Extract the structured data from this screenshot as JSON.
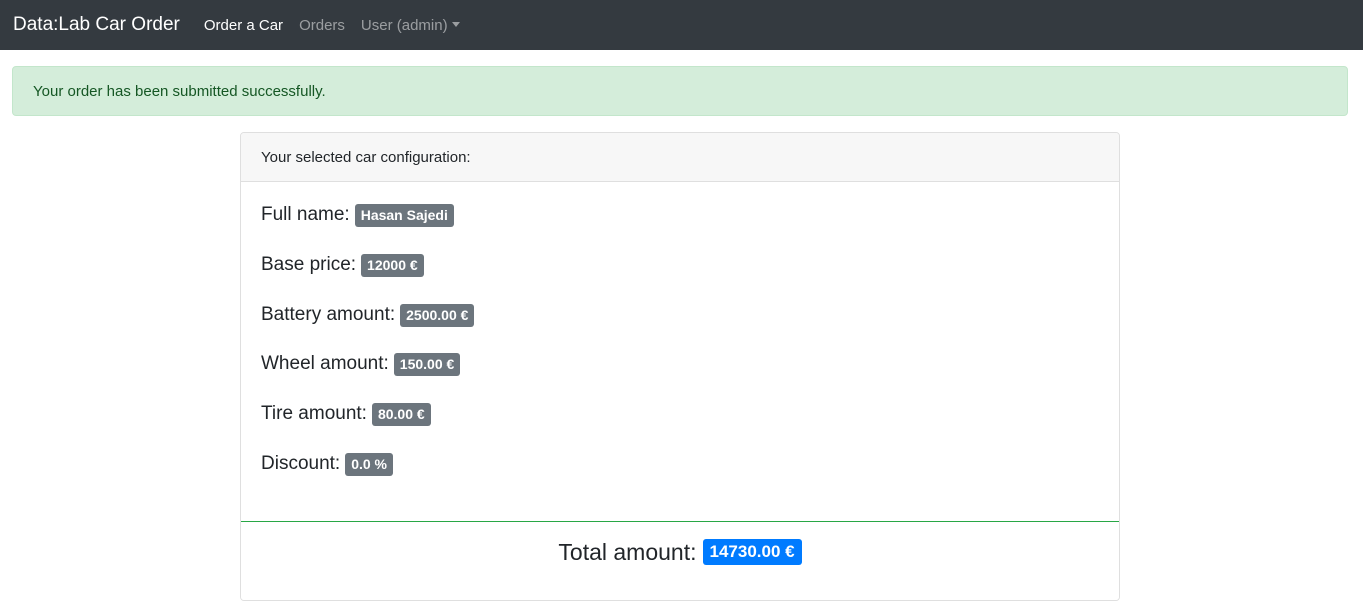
{
  "navbar": {
    "brand": "Data:Lab Car Order",
    "links": [
      {
        "label": "Order a Car"
      },
      {
        "label": "Orders"
      },
      {
        "label": "User (admin)"
      }
    ]
  },
  "alert": {
    "message": "Your order has been submitted successfully."
  },
  "card": {
    "header": "Your selected car configuration:",
    "rows": [
      {
        "label": "Full name:",
        "value": "Hasan Sajedi"
      },
      {
        "label": "Base price:",
        "value": "12000 €"
      },
      {
        "label": "Battery amount:",
        "value": "2500.00 €"
      },
      {
        "label": "Wheel amount:",
        "value": "150.00 €"
      },
      {
        "label": "Tire amount:",
        "value": "80.00 €"
      },
      {
        "label": "Discount:",
        "value": "0.0 %"
      }
    ],
    "total": {
      "label": "Total amount:",
      "value": "14730.00 €"
    }
  },
  "colors": {
    "navbar_bg": "#343a40",
    "alert_bg": "#d4edda",
    "alert_text": "#155724",
    "badge_secondary": "#6c757d",
    "badge_primary": "#007bff",
    "footer_border": "#28a745"
  }
}
